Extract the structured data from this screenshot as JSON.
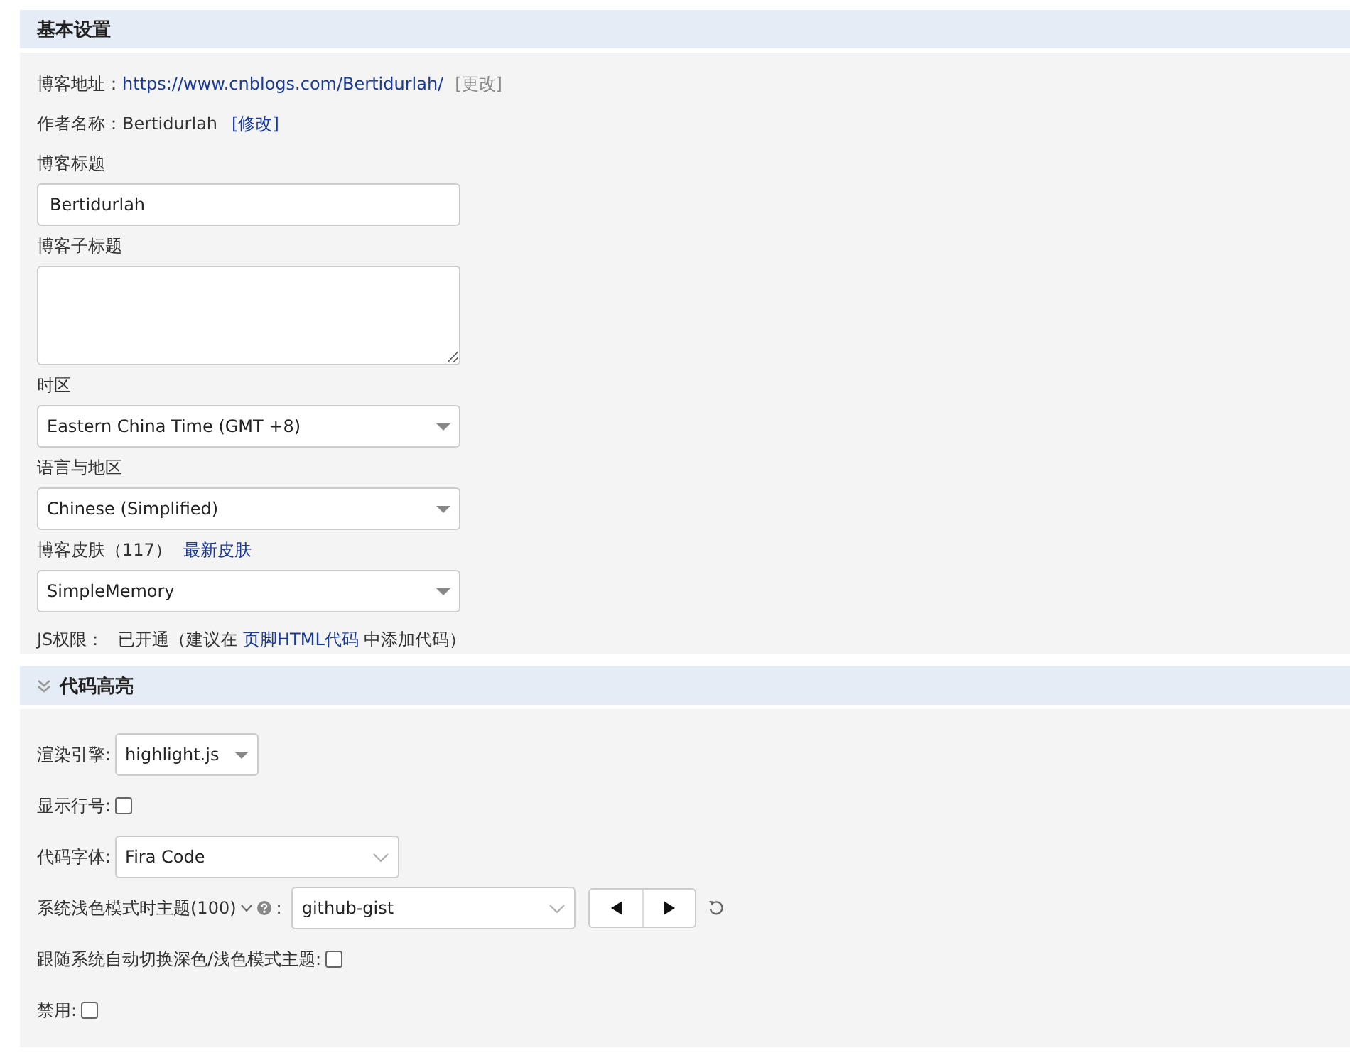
{
  "basic": {
    "title": "基本设置",
    "blog_url": {
      "label": "博客地址：",
      "url": "https://www.cnblogs.com/Bertidurlah/",
      "action": "[更改]"
    },
    "author": {
      "label": "作者名称：",
      "value": "Bertidurlah",
      "action": "[修改]"
    },
    "fields": [
      {
        "kind": "text",
        "label": "博客标题",
        "value": "Bertidurlah"
      },
      {
        "kind": "textarea",
        "label": "博客子标题"
      },
      {
        "kind": "select",
        "label": "时区",
        "value": "Eastern China Time (GMT +8)"
      },
      {
        "kind": "select",
        "label": "语言与地区",
        "value": "Chinese (Simplified)"
      },
      {
        "kind": "select",
        "label": "博客皮肤（117）",
        "link": "最新皮肤",
        "value": "SimpleMemory"
      }
    ],
    "js": {
      "label": "JS权限：",
      "before": "已开通（建议在",
      "link": "页脚HTML代码",
      "after": "中添加代码）"
    }
  },
  "highlight": {
    "title": "代码高亮",
    "expanded": true,
    "rows": [
      {
        "kind": "select",
        "label": "渲染引擎:",
        "value": "highlight.js"
      },
      {
        "kind": "checkbox",
        "label": "显示行号:",
        "checked": false
      },
      {
        "kind": "combo",
        "label": "代码字体:",
        "value": "Fira Code"
      },
      {
        "kind": "theme",
        "label": "系统浅色模式时主题(100)",
        "separator": ":",
        "value": "github-gist"
      },
      {
        "kind": "checkbox",
        "label": "跟随系统自动切换深色/浅色模式主题:",
        "checked": false
      },
      {
        "kind": "checkbox",
        "label": "禁用:",
        "checked": false
      }
    ]
  }
}
